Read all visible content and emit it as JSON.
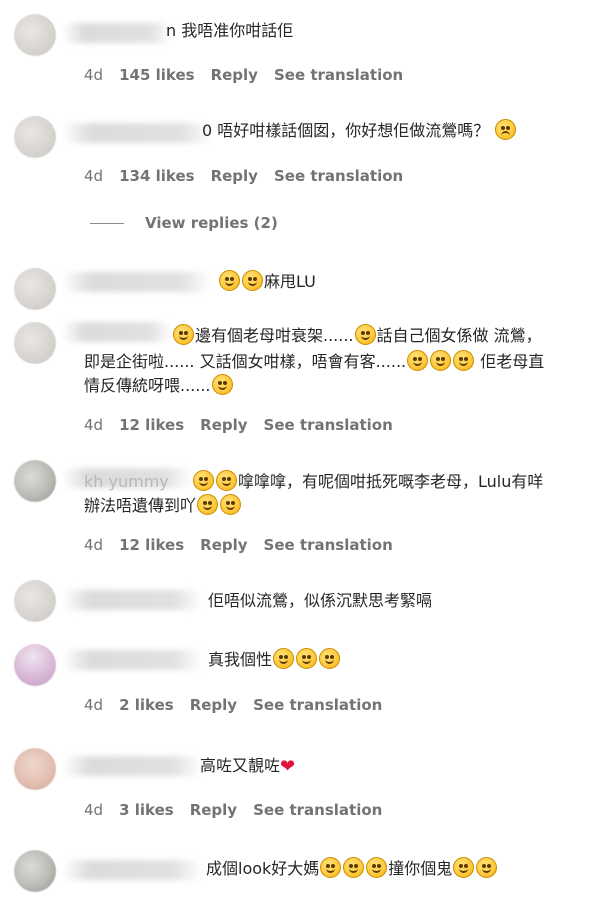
{
  "comments": [
    {
      "text": "n 我唔准你咁話佢",
      "time": "4d",
      "likes": "145 likes",
      "reply": "Reply",
      "translate": "See translation"
    },
    {
      "text": "0 唔好咁樣話個囡，你好想佢做流鶯嗎？",
      "time": "4d",
      "likes": "134 likes",
      "reply": "Reply",
      "translate": "See translation"
    },
    {
      "text": "麻甩LU"
    },
    {
      "text_a": "邊有個老母咁衰架......",
      "text_b": "話自己個女係做 流鶯，",
      "text_c": "即是企街啦...... 又話個女咁樣，唔會有客......",
      "text_d": "佢老母直",
      "text_e": "情反傳統呀喂......",
      "time": "4d",
      "likes": "12 likes",
      "reply": "Reply",
      "translate": "See translation"
    },
    {
      "text_a": "kh   yummy",
      "text_b": "嗱嗱嗱，有呢個咁抵死嘅李老母，Lulu有咩",
      "text_c": "辦法唔遺傳到吖",
      "time": "4d",
      "likes": "12 likes",
      "reply": "Reply",
      "translate": "See translation"
    },
    {
      "text": "佢唔似流鶯，似係沉默思考緊嗝"
    },
    {
      "text": "真我個性",
      "time": "4d",
      "likes": "2 likes",
      "reply": "Reply",
      "translate": "See translation"
    },
    {
      "text": "高咗又靚咗",
      "time": "4d",
      "likes": "3 likes",
      "reply": "Reply",
      "translate": "See translation"
    },
    {
      "text_a": "成個look好大媽",
      "text_b": "撞你個鬼"
    }
  ],
  "view_replies": "View replies (2)",
  "icons": {
    "emoji": "emoji-icon",
    "heart": "heart-icon"
  },
  "colors": {
    "text": "#262626",
    "meta": "#737373",
    "heart": "#e0123a"
  }
}
